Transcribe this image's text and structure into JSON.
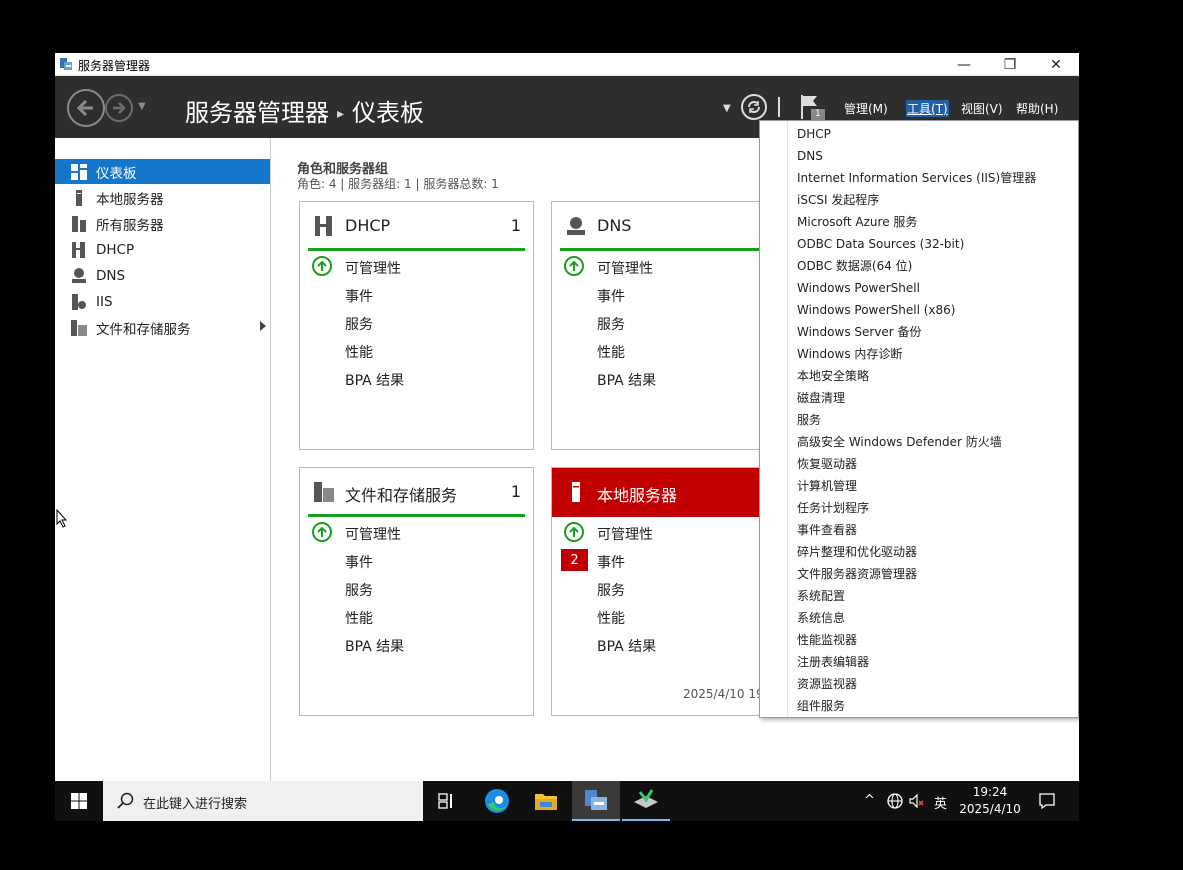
{
  "window": {
    "title": "服务器管理器",
    "controls": {
      "minimize": "—",
      "restore": "❐",
      "close": "✕"
    }
  },
  "header": {
    "breadcrumb_root": "服务器管理器",
    "breadcrumb_sep": "▸",
    "breadcrumb_page": "仪表板",
    "flag_count": "1",
    "menus": [
      {
        "label": "管理(M)"
      },
      {
        "label": "工具(T)"
      },
      {
        "label": "视图(V)"
      },
      {
        "label": "帮助(H)"
      }
    ]
  },
  "sidebar": {
    "items": [
      {
        "label": "仪表板",
        "icon": "dashboard-icon"
      },
      {
        "label": "本地服务器",
        "icon": "server-icon"
      },
      {
        "label": "所有服务器",
        "icon": "servers-icon"
      },
      {
        "label": "DHCP",
        "icon": "dhcp-icon"
      },
      {
        "label": "DNS",
        "icon": "dns-icon"
      },
      {
        "label": "IIS",
        "icon": "iis-icon"
      },
      {
        "label": "文件和存储服务",
        "icon": "storage-icon"
      }
    ]
  },
  "main": {
    "group_title": "角色和服务器组",
    "group_subtitle": "角色: 4 | 服务器组: 1 | 服务器总数: 1",
    "tiles": [
      {
        "name": "DHCP",
        "count": "1",
        "rows": [
          "可管理性",
          "事件",
          "服务",
          "性能",
          "BPA 结果"
        ]
      },
      {
        "name": "DNS",
        "count": "",
        "rows": [
          "可管理性",
          "事件",
          "服务",
          "性能",
          "BPA 结果"
        ]
      },
      {
        "name": "文件和存储服务",
        "count": "1",
        "rows": [
          "可管理性",
          "事件",
          "服务",
          "性能",
          "BPA 结果"
        ]
      },
      {
        "name": "本地服务器",
        "count": "",
        "event_badge": "2",
        "rows": [
          "可管理性",
          "事件",
          "服务",
          "性能",
          "BPA 结果"
        ],
        "timestamp": "2025/4/10 19"
      }
    ]
  },
  "tools_menu": {
    "items": [
      "DHCP",
      "DNS",
      "Internet Information Services (IIS)管理器",
      "iSCSI 发起程序",
      "Microsoft Azure 服务",
      "ODBC Data Sources (32-bit)",
      "ODBC 数据源(64 位)",
      "Windows PowerShell",
      "Windows PowerShell (x86)",
      "Windows Server 备份",
      "Windows 内存诊断",
      "本地安全策略",
      "磁盘清理",
      "服务",
      "高级安全 Windows Defender 防火墙",
      "恢复驱动器",
      "计算机管理",
      "任务计划程序",
      "事件查看器",
      "碎片整理和优化驱动器",
      "文件服务器资源管理器",
      "系统配置",
      "系统信息",
      "性能监视器",
      "注册表编辑器",
      "资源监视器",
      "组件服务"
    ]
  },
  "taskbar": {
    "search_placeholder": "在此键入进行搜索",
    "ime": "英",
    "time": "19:24",
    "date": "2025/4/10"
  },
  "colors": {
    "accent_blue": "#1477c9",
    "header_dark": "#2e2e2e",
    "ok_green": "#17a11e",
    "alert_red": "#c00000"
  }
}
